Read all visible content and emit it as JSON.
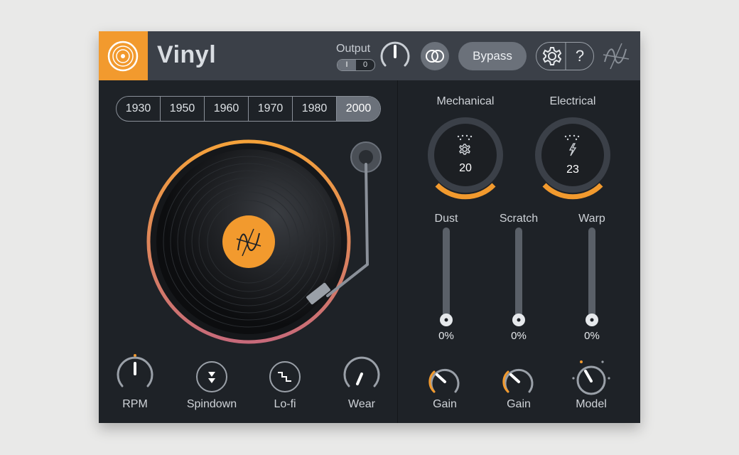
{
  "app": {
    "title": "Vinyl"
  },
  "header": {
    "output_label": "Output",
    "output_switch": [
      "I",
      "0"
    ],
    "bypass_label": "Bypass",
    "help_label": "?"
  },
  "eras": [
    "1930",
    "1950",
    "1960",
    "1970",
    "1980",
    "2000"
  ],
  "selected_era": "2000",
  "turntable": {
    "controls": {
      "rpm": "RPM",
      "spindown": "Spindown",
      "lofi": "Lo-fi",
      "wear": "Wear"
    }
  },
  "noise": {
    "mechanical": {
      "label": "Mechanical",
      "value": "20"
    },
    "electrical": {
      "label": "Electrical",
      "value": "23"
    }
  },
  "sliders": [
    {
      "label": "Dust",
      "value": "0%"
    },
    {
      "label": "Scratch",
      "value": "0%"
    },
    {
      "label": "Warp",
      "value": "0%"
    }
  ],
  "bottom_knobs": {
    "gain1": "Gain",
    "gain2": "Gain",
    "model": "Model"
  },
  "colors": {
    "accent": "#f29a2e",
    "panel": "#1e2227",
    "header": "#3b4048",
    "record_ring_top": "#f5a23a",
    "record_ring_bottom": "#c76a7a"
  }
}
